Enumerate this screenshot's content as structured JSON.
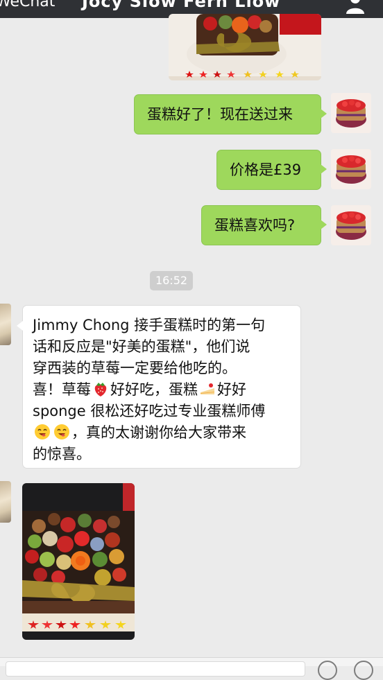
{
  "header": {
    "back_label": "WeChat",
    "title": "Jocy Siow Fern Liow",
    "profile_icon": "person-icon"
  },
  "messages": [
    {
      "id": "m1",
      "side": "right",
      "type": "text",
      "text": "蛋糕好了！现在送过来"
    },
    {
      "id": "m2",
      "side": "right",
      "type": "text",
      "text": "价格是£39"
    },
    {
      "id": "m3",
      "side": "right",
      "type": "text",
      "text": "蛋糕喜欢吗?"
    },
    {
      "id": "m4",
      "side": "left",
      "type": "text",
      "lines": [
        "Jimmy Chong 接手蛋糕时的第一句",
        "话和反应是\"好美的蛋糕\"，他们说",
        "穿西装的草莓一定要给他吃的。",
        "喜！草莓",
        "好好吃，蛋糕",
        "好好",
        "sponge 很松还好吃过专业蛋糕师傅",
        "，真的太谢谢你给大家带来",
        "的惊喜。"
      ]
    }
  ],
  "timestamp": "16:52",
  "emoji": [
    "strawberry",
    "cake-slice",
    "smiling-face",
    "smiling-face"
  ],
  "colors": {
    "bubble_out": "#9ed85c",
    "bubble_in": "#ffffff",
    "background": "#ebebeb",
    "topbar": "#2f3135"
  }
}
